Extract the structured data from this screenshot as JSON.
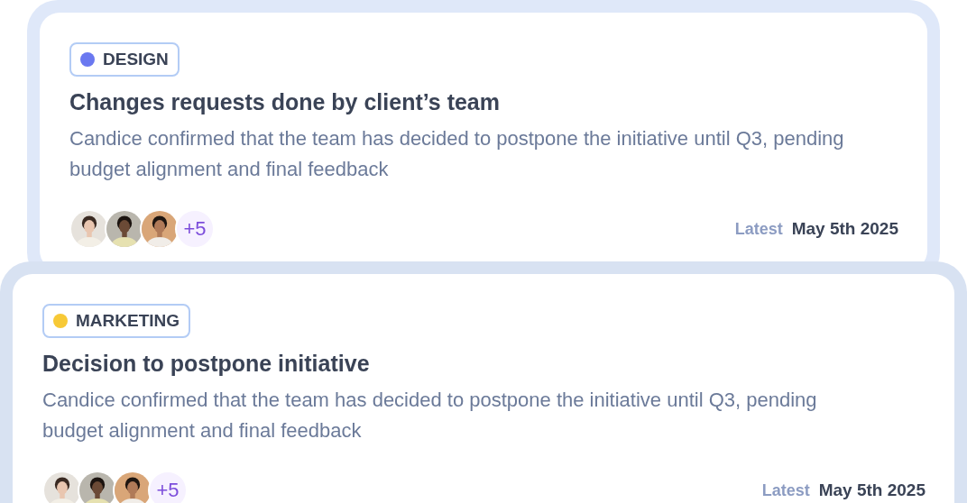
{
  "cards": [
    {
      "tag": {
        "label": "DESIGN",
        "color": "#6a78f0"
      },
      "title": "Changes requests done by client’s team",
      "description": "Candice confirmed that the team has decided to postpone the initiative until Q3, pending budget alignment and final feedback",
      "more": "+5",
      "latest_label": "Latest",
      "date": "May 5th 2025"
    },
    {
      "tag": {
        "label": "MARKETING",
        "color": "#f7c936"
      },
      "title": "Decision to postpone initiative",
      "description": "Candice confirmed that the team has decided to postpone the initiative until Q3, pending budget alignment and final feedback",
      "more": "+5",
      "latest_label": "Latest",
      "date": "May 5th 2025"
    }
  ]
}
